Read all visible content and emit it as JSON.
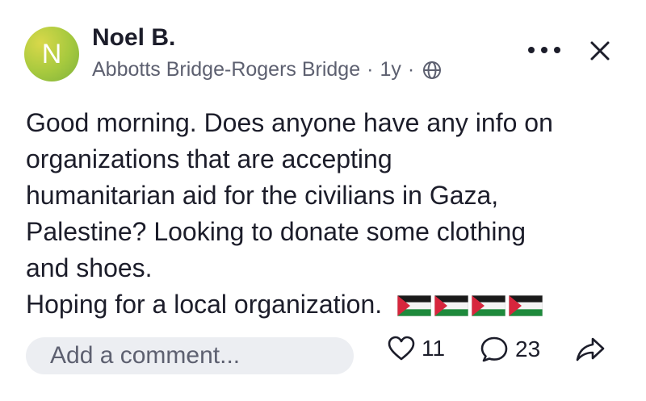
{
  "post": {
    "avatar_letter": "N",
    "author": "Noel B.",
    "location": "Abbotts Bridge-Rogers Bridge",
    "separator": "·",
    "age": "1y",
    "visibility_icon": "globe-icon",
    "body_lines": [
      "Good morning. Does anyone have any info on",
      "organizations that are accepting",
      "humanitarian aid for the civilians in Gaza,",
      "Palestine? Looking to donate some clothing",
      "and shoes.",
      "Hoping for a local organization."
    ],
    "flag_count": 4
  },
  "actions": {
    "comment_placeholder": "Add a comment...",
    "likes": "11",
    "replies": "23"
  },
  "colors": {
    "avatar": "#a6c93e",
    "text": "#1c1d2a",
    "muted": "#5d6070",
    "comment_bg": "#eceef2"
  }
}
